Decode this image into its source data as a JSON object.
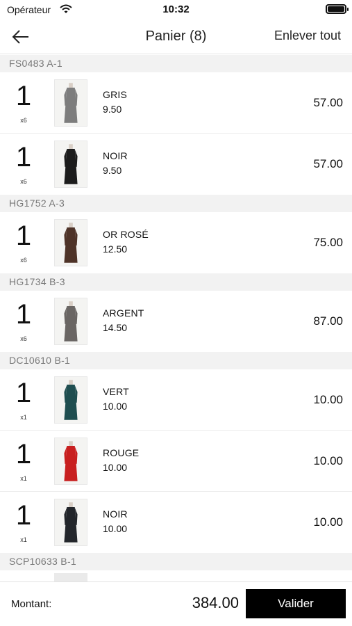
{
  "status_bar": {
    "carrier": "Opérateur",
    "time": "10:32",
    "wifi_icon": "wifi-icon",
    "battery_icon": "battery-icon"
  },
  "nav": {
    "back_icon": "arrow-left-icon",
    "title": "Panier (8)",
    "clear_all": "Enlever tout"
  },
  "groups": [
    {
      "header": "FS0483 A-1",
      "items": [
        {
          "quantity": "1",
          "multiplier": "x6",
          "color": "GRIS",
          "unit_price": "9.50",
          "total": "57.00",
          "swatch": "#7d7d7d"
        },
        {
          "quantity": "1",
          "multiplier": "x6",
          "color": "NOIR",
          "unit_price": "9.50",
          "total": "57.00",
          "swatch": "#1c1c1c"
        }
      ]
    },
    {
      "header": "HG1752 A-3",
      "items": [
        {
          "quantity": "1",
          "multiplier": "x6",
          "color": "OR ROSÉ",
          "unit_price": "12.50",
          "total": "75.00",
          "swatch": "#4e3328"
        }
      ]
    },
    {
      "header": "HG1734  B-3",
      "items": [
        {
          "quantity": "1",
          "multiplier": "x6",
          "color": "ARGENT",
          "unit_price": "14.50",
          "total": "87.00",
          "swatch": "#6a6664"
        }
      ]
    },
    {
      "header": "DC10610 B-1",
      "items": [
        {
          "quantity": "1",
          "multiplier": "x1",
          "color": "VERT",
          "unit_price": "10.00",
          "total": "10.00",
          "swatch": "#1f4e50"
        },
        {
          "quantity": "1",
          "multiplier": "x1",
          "color": "ROUGE",
          "unit_price": "10.00",
          "total": "10.00",
          "swatch": "#c81f1f"
        },
        {
          "quantity": "1",
          "multiplier": "x1",
          "color": "NOIR",
          "unit_price": "10.00",
          "total": "10.00",
          "swatch": "#23262b"
        }
      ]
    },
    {
      "header": "SCP10633 B-1",
      "items": []
    }
  ],
  "footer": {
    "total_label": "Montant:",
    "total_value": "384.00",
    "validate_label": "Valider"
  }
}
